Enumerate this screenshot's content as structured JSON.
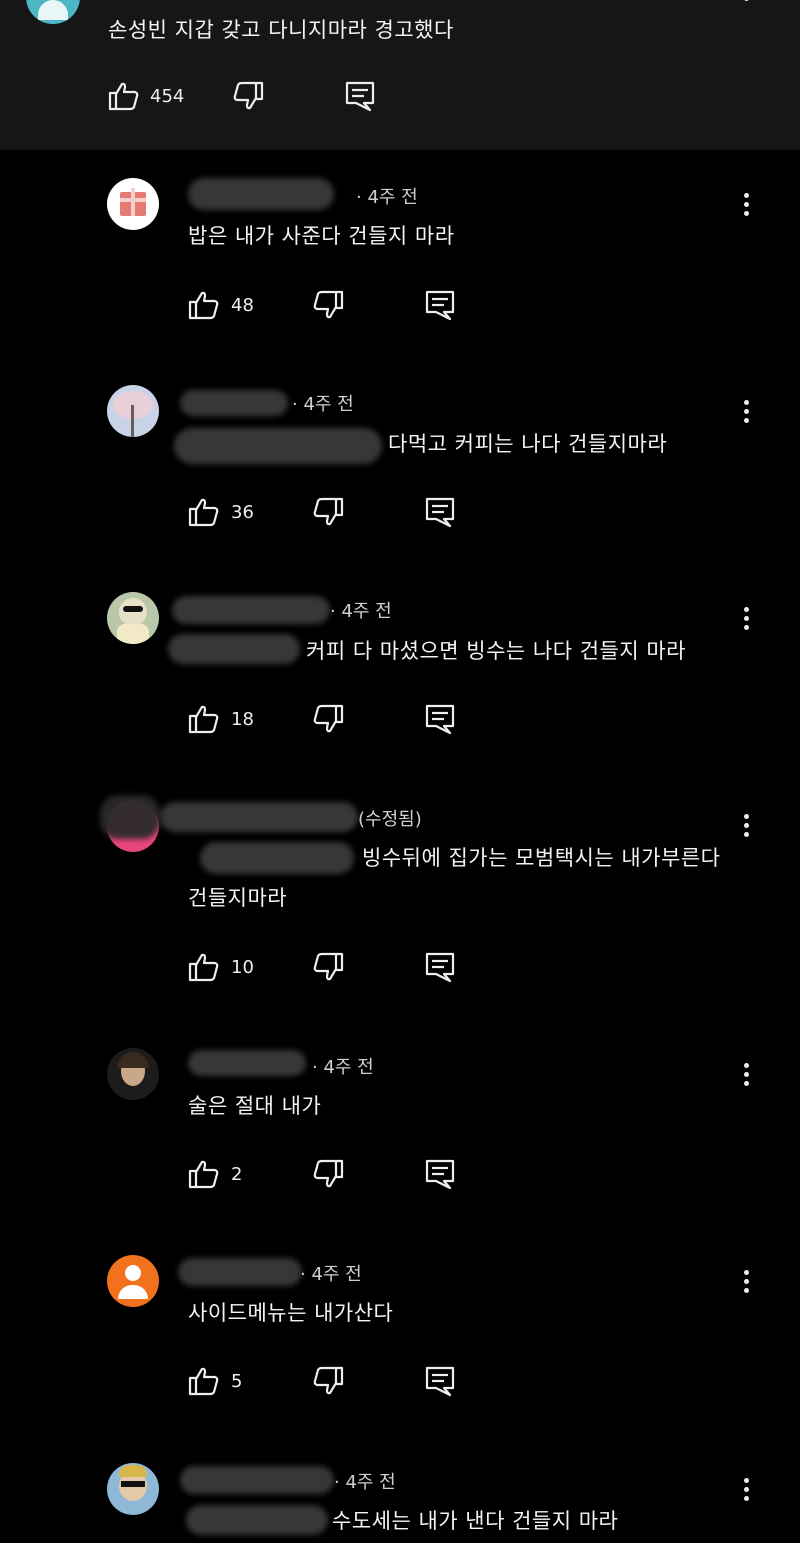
{
  "parent_comment": {
    "text": "손성빈 지갑 갖고 다니지마라 경고했다",
    "likes": "454"
  },
  "replies": [
    {
      "meta": "· 4주 전",
      "text": "밥은 내가 사준다 건들지 마라",
      "text2": "",
      "likes": "48"
    },
    {
      "meta": "· 4주 전",
      "text": "다먹고 커피는 나다 건들지마라",
      "text2": "",
      "likes": "36"
    },
    {
      "meta": "· 4주 전",
      "text": "커피 다 마셨으면 빙수는 나다 건들지 마라",
      "text2": "",
      "likes": "18"
    },
    {
      "meta": "(수정됨)",
      "text": "빙수뒤에 집가는 모범택시는 내가부른다",
      "text2": "건들지마라",
      "likes": "10"
    },
    {
      "meta": "· 4주 전",
      "text": "술은 절대 내가",
      "text2": "",
      "likes": "2"
    },
    {
      "meta": "· 4주 전",
      "text": "사이드메뉴는 내가산다",
      "text2": "",
      "likes": "5"
    },
    {
      "meta": "· 4주 전",
      "text": "수도세는 내가 낸다 건들지 마라",
      "text2": "",
      "likes": ""
    }
  ],
  "icons": {
    "like": "thumbs-up-icon",
    "dislike": "thumbs-down-icon",
    "reply": "reply-comment-icon",
    "more": "more-vert-icon"
  },
  "colors": {
    "parent_bg": "#161616",
    "page_bg": "#000000",
    "avatar_teal": "#4db6c4",
    "avatar_pink": "#e8457a",
    "avatar_orange": "#f2711c"
  }
}
